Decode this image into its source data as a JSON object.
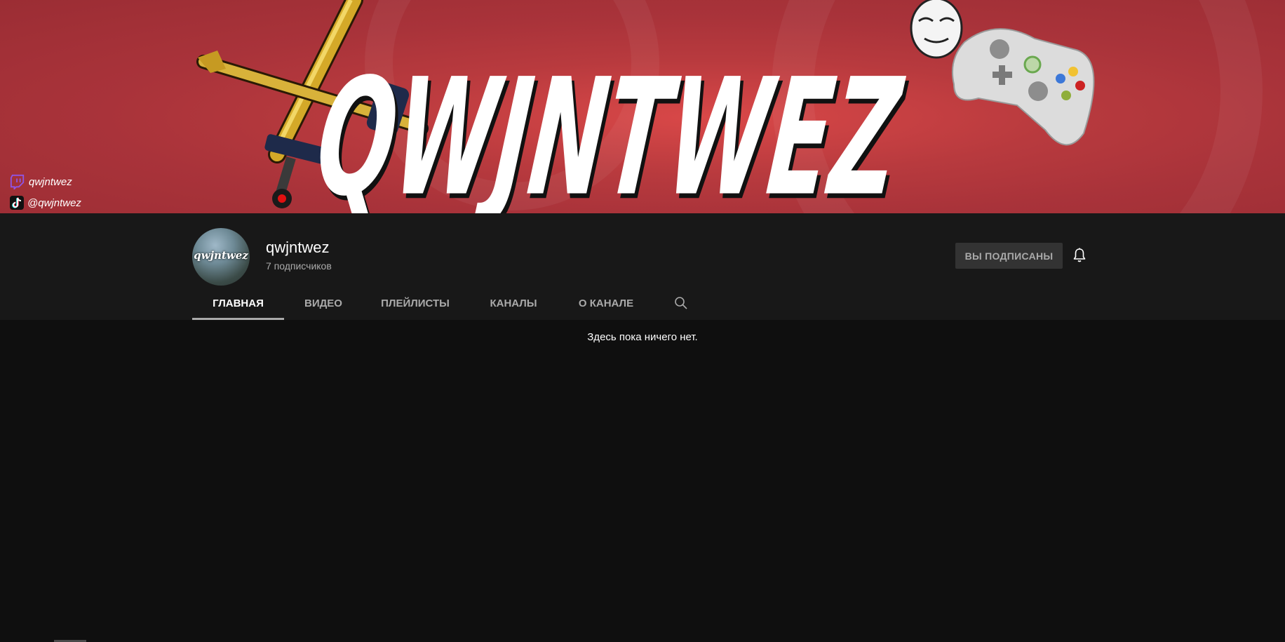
{
  "banner": {
    "title_art": "QWJNTWEZ",
    "links": [
      {
        "icon": "twitch-icon",
        "label": "qwjntwez"
      },
      {
        "icon": "tiktok-icon",
        "label": "@qwjntwez"
      }
    ],
    "colors": {
      "background": "#b83a3e",
      "twitch": "#8f54e4"
    }
  },
  "channel": {
    "avatar_text": "qwjntwez",
    "name": "qwjntwez",
    "subscribers": "7 подписчиков",
    "subscribe_label": "ВЫ ПОДПИСАНЫ"
  },
  "tabs": [
    {
      "label": "ГЛАВНАЯ",
      "active": true
    },
    {
      "label": "ВИДЕО",
      "active": false
    },
    {
      "label": "ПЛЕЙЛИСТЫ",
      "active": false
    },
    {
      "label": "КАНАЛЫ",
      "active": false
    },
    {
      "label": "О КАНАЛЕ",
      "active": false
    }
  ],
  "content": {
    "empty_message": "Здесь пока ничего нет."
  }
}
